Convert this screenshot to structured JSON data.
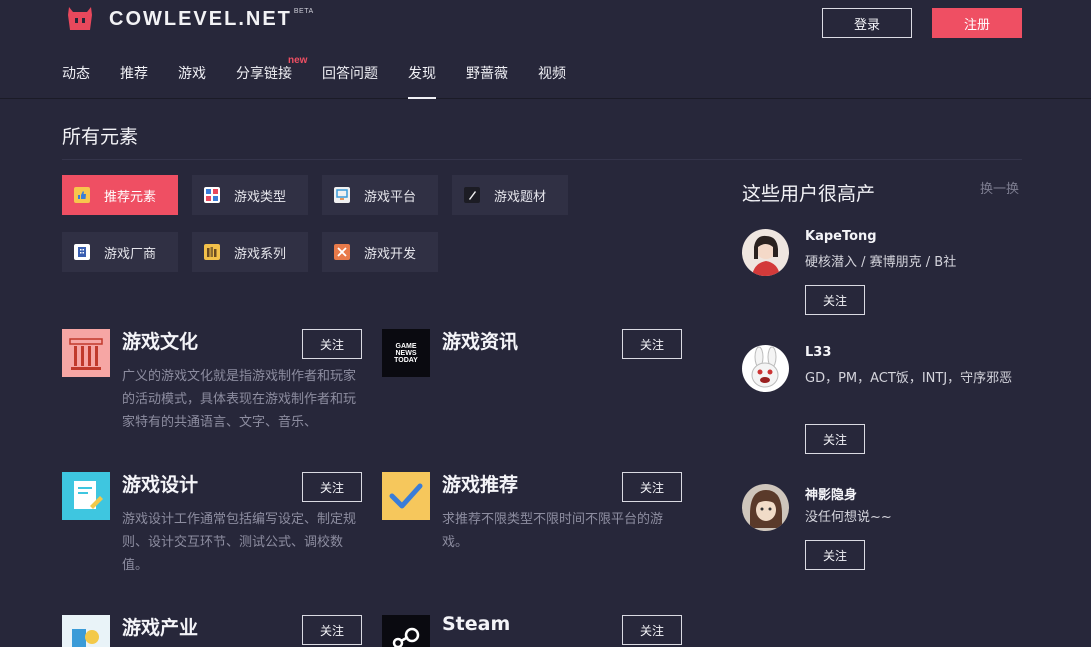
{
  "header": {
    "logo_text": "COWLEVEL.NET",
    "logo_badge": "BETA",
    "login_label": "登录",
    "register_label": "注册",
    "accent_color": "#ef4f63"
  },
  "nav": {
    "items": [
      {
        "label": "动态"
      },
      {
        "label": "推荐"
      },
      {
        "label": "游戏"
      },
      {
        "label": "分享链接",
        "badge": "new"
      },
      {
        "label": "回答问题"
      },
      {
        "label": "发现",
        "active": true
      },
      {
        "label": "野蔷薇"
      },
      {
        "label": "视频"
      }
    ]
  },
  "main": {
    "section_title": "所有元素",
    "chips": [
      {
        "label": "推荐元素",
        "icon": "thumbs-up-icon",
        "active": true
      },
      {
        "label": "游戏类型",
        "icon": "grid-icon"
      },
      {
        "label": "游戏平台",
        "icon": "platform-icon"
      },
      {
        "label": "游戏题材",
        "icon": "pen-icon"
      },
      {
        "label": "游戏厂商",
        "icon": "building-icon"
      },
      {
        "label": "游戏系列",
        "icon": "books-icon"
      },
      {
        "label": "游戏开发",
        "icon": "dev-tools-icon"
      }
    ],
    "topics": [
      {
        "title": "游戏文化",
        "follow": "关注",
        "desc": "广义的游戏文化就是指游戏制作者和玩家的活动模式，具体表现在游戏制作者和玩家特有的共通语言、文字、音乐、",
        "icon": "pillar-icon"
      },
      {
        "title": "游戏资讯",
        "follow": "关注",
        "desc": "",
        "icon": "game-news-icon",
        "icon_text": "GAME NEWS TODAY"
      },
      {
        "title": "游戏设计",
        "follow": "关注",
        "desc": "游戏设计工作通常包括编写设定、制定规则、设计交互环节、测试公式、调校数值。",
        "icon": "design-doc-icon"
      },
      {
        "title": "游戏推荐",
        "follow": "关注",
        "desc": "求推荐不限类型不限时间不限平台的游戏。",
        "icon": "checkmark-icon"
      },
      {
        "title": "游戏产业",
        "follow": "关注",
        "desc": "",
        "icon": "industry-icon"
      },
      {
        "title": "Steam",
        "follow": "关注",
        "desc": "",
        "icon": "steam-icon"
      }
    ]
  },
  "sidebar": {
    "title": "这些用户很高产",
    "refresh_label": "换一换",
    "users": [
      {
        "name": "KapeTong",
        "bio": "硬核潜入 / 赛博朋克 / B社",
        "follow": "关注",
        "avatar": "girl-avatar"
      },
      {
        "name": "L33",
        "bio": "GD，PM，ACT饭，INTJ，守序邪恶",
        "follow": "关注",
        "avatar": "rabbid-avatar"
      },
      {
        "name": "神影隐身",
        "bio": "没任何想说~~",
        "follow": "关注",
        "avatar": "anime-avatar"
      }
    ]
  }
}
